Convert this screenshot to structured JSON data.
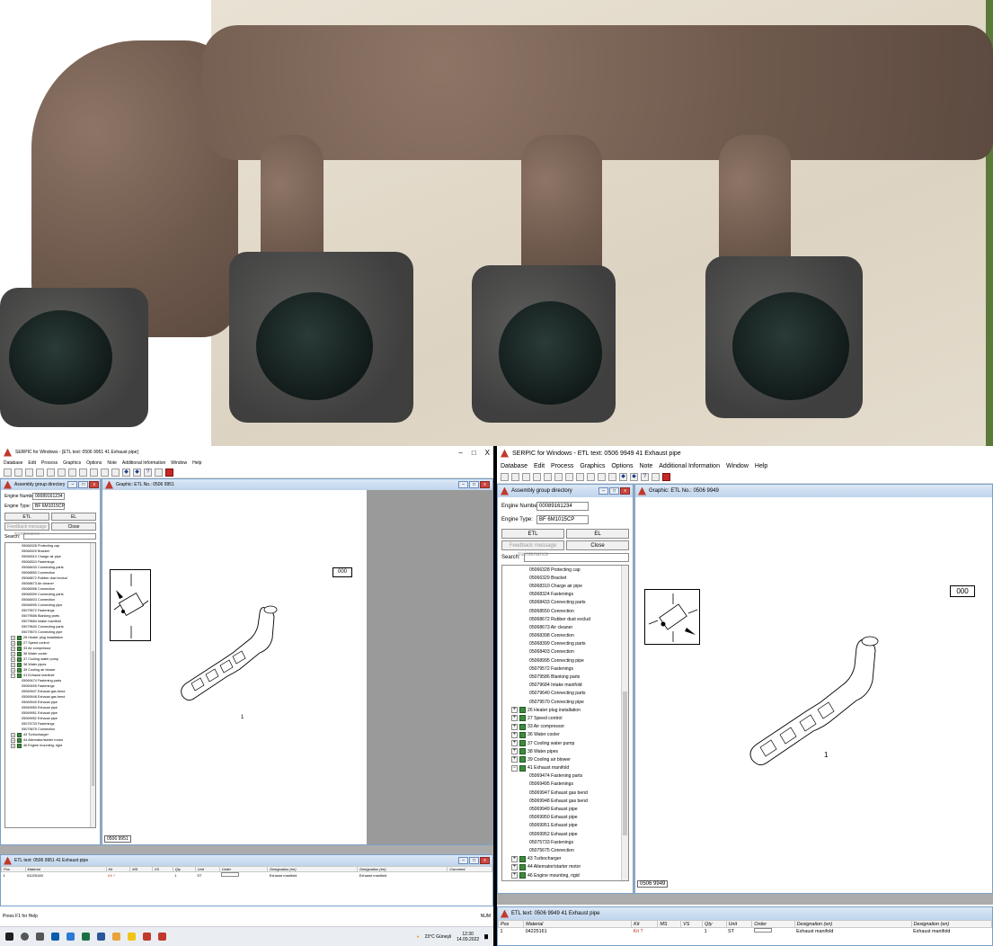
{
  "left_window": {
    "title": "SERPIC for Windows - [ETL text: 0506 9951  41  Exhaust pipe]",
    "title_buttons": [
      "–",
      "□",
      "X"
    ],
    "menu": [
      "Database",
      "Edit",
      "Process",
      "Graphics",
      "Options",
      "Note",
      "Additional Information",
      "Window",
      "Help"
    ],
    "assembly": {
      "title": "Assembly group directory",
      "engine_number_label": "Engine Number:",
      "engine_number": "00089161234",
      "engine_type_label": "Engine Type:",
      "engine_type": "BF 6M1015CP",
      "etl_button": "ETL",
      "el_button": "EL",
      "feedback_button": "Feedback message maintenance",
      "close_button": "Close",
      "search_label": "Search:"
    },
    "graphic": {
      "title": "Graphic: ETL No.: 0506 9951",
      "ref_label": "000",
      "pos_label": "1",
      "image_id": "0506 9951"
    },
    "etl": {
      "title": "ETL text: 0506 9951  41  Exhaust pipe",
      "columns": [
        "Pos",
        "Material",
        "Kit",
        "MS",
        "VS",
        "Qty",
        "Unit",
        "Order",
        "Designation (en)",
        "Designation (en)",
        "Comment"
      ],
      "rows": [
        {
          "pos": "1",
          "material": "04225165",
          "kit": "Kit ?",
          "qty": "1",
          "unit": "ST",
          "des1": "Exhaust manifold",
          "des2": "Exhaust manifold"
        }
      ]
    },
    "status_left": "Press F1 for Help",
    "status_right": "NUM",
    "tray": {
      "weather": "23°C Güneşli",
      "time": "12:30",
      "date": "14.09.2022"
    }
  },
  "right_window": {
    "title": "SERPIC for Windows - ETL text: 0506 9949  41  Exhaust pipe",
    "menu": [
      "Database",
      "Edit",
      "Process",
      "Graphics",
      "Options",
      "Note",
      "Additional Information",
      "Window",
      "Help"
    ],
    "assembly": {
      "title": "Assembly group directory",
      "engine_number_label": "Engine Number:",
      "engine_number": "00089161234",
      "engine_type_label": "Engine Type:",
      "engine_type": "BF 6M1015CP",
      "etl_button": "ETL",
      "el_button": "EL",
      "feedback_button": "Feedback message maintenance",
      "close_button": "Close",
      "search_label": "Search:"
    },
    "graphic": {
      "title": "Graphic: ETL No.: 0506 9949",
      "ref_label": "000",
      "pos_label": "1",
      "image_id": "0506 9949"
    },
    "etl": {
      "title": "ETL text: 0506 9949  41  Exhaust pipe",
      "columns": [
        "Pos",
        "Material",
        "Kit",
        "MS",
        "VS",
        "Qty",
        "Unit",
        "Order",
        "Designation (en)",
        "Designation (en)"
      ],
      "rows": [
        {
          "pos": "1",
          "material": "04225161",
          "kit": "Kit ?",
          "qty": "1",
          "unit": "ST",
          "des1": "Exhaust manifold",
          "des2": "Exhaust manifold"
        }
      ]
    }
  },
  "tree_left": [
    {
      "kind": "leaf",
      "label": "05066328  Protecting cap"
    },
    {
      "kind": "leaf",
      "label": "05066329  Bracket"
    },
    {
      "kind": "leaf",
      "label": "05068310  Charge air pipe"
    },
    {
      "kind": "leaf",
      "label": "05068324  Fastenings"
    },
    {
      "kind": "leaf",
      "label": "05068433  Connecting parts"
    },
    {
      "kind": "leaf",
      "label": "05068550  Connection"
    },
    {
      "kind": "leaf",
      "label": "05068672  Rubber dust exclud"
    },
    {
      "kind": "leaf",
      "label": "05068673  Air cleaner"
    },
    {
      "kind": "leaf",
      "label": "05068398  Connection"
    },
    {
      "kind": "leaf",
      "label": "05068399  Connecting parts"
    },
    {
      "kind": "leaf",
      "label": "05068403  Connection"
    },
    {
      "kind": "leaf",
      "label": "05068995  Connecting pipe"
    },
    {
      "kind": "leaf",
      "label": "05079572  Fastenings"
    },
    {
      "kind": "leaf",
      "label": "05079586  Blanking parts"
    },
    {
      "kind": "leaf",
      "label": "05079684  Intake manifold"
    },
    {
      "kind": "leaf",
      "label": "05079640  Connecting parts"
    },
    {
      "kind": "leaf",
      "label": "05079570  Connecting pipe"
    },
    {
      "kind": "grp",
      "label": "26  Heater plug installation"
    },
    {
      "kind": "grp",
      "label": "27  Speed control"
    },
    {
      "kind": "grp",
      "label": "33  Air compressor"
    },
    {
      "kind": "grp",
      "label": "36  Water cooler"
    },
    {
      "kind": "grp",
      "label": "37  Cooling water pump"
    },
    {
      "kind": "grp",
      "label": "38  Water pipes"
    },
    {
      "kind": "grp",
      "label": "39  Cooling air blower"
    },
    {
      "kind": "grp",
      "label": "41  Exhaust manifold",
      "open": true
    },
    {
      "kind": "leaf",
      "label": "05069474  Fastening parts"
    },
    {
      "kind": "leaf",
      "label": "05069495  Fastenings"
    },
    {
      "kind": "leaf",
      "label": "05069947  Exhaust gas bend"
    },
    {
      "kind": "leaf",
      "label": "05069948  Exhaust gas bend"
    },
    {
      "kind": "leaf",
      "label": "05069949  Exhaust pipe"
    },
    {
      "kind": "leaf",
      "label": "05069950  Exhaust pipe"
    },
    {
      "kind": "leaf",
      "label": "05069951  Exhaust pipe"
    },
    {
      "kind": "leaf",
      "label": "05069952  Exhaust pipe"
    },
    {
      "kind": "leaf",
      "label": "05075733  Fastenings"
    },
    {
      "kind": "leaf",
      "label": "05075675  Connection"
    },
    {
      "kind": "grp",
      "label": "43  Turbocharger"
    },
    {
      "kind": "grp",
      "label": "44  Alternator/starter motor"
    },
    {
      "kind": "grp",
      "label": "46  Engine mounting, rigid"
    }
  ],
  "tree_right": [
    {
      "kind": "leaf",
      "label": "05066328  Protecting cap"
    },
    {
      "kind": "leaf",
      "label": "05066329  Bracket"
    },
    {
      "kind": "leaf",
      "label": "05068310  Charge air pipe"
    },
    {
      "kind": "leaf",
      "label": "05068324  Fastenings"
    },
    {
      "kind": "leaf",
      "label": "05068433  Connecting parts"
    },
    {
      "kind": "leaf",
      "label": "05068550  Connection"
    },
    {
      "kind": "leaf",
      "label": "05068672  Rubber dust exclud"
    },
    {
      "kind": "leaf",
      "label": "05068673  Air cleaner"
    },
    {
      "kind": "leaf",
      "label": "05068398  Connection"
    },
    {
      "kind": "leaf",
      "label": "05068399  Connecting parts"
    },
    {
      "kind": "leaf",
      "label": "05068403  Connection"
    },
    {
      "kind": "leaf",
      "label": "05068995  Connecting pipe"
    },
    {
      "kind": "leaf",
      "label": "05079572  Fastenings"
    },
    {
      "kind": "leaf",
      "label": "05079586  Blanking parts"
    },
    {
      "kind": "leaf",
      "label": "05079684  Intake manifold"
    },
    {
      "kind": "leaf",
      "label": "05079640  Connecting parts"
    },
    {
      "kind": "leaf",
      "label": "05079570  Connecting pipe"
    },
    {
      "kind": "grp",
      "label": "26  Heater plug installation"
    },
    {
      "kind": "grp",
      "label": "27  Speed control"
    },
    {
      "kind": "grp",
      "label": "33  Air compressor"
    },
    {
      "kind": "grp",
      "label": "36  Water cooler"
    },
    {
      "kind": "grp",
      "label": "37  Cooling water pump"
    },
    {
      "kind": "grp",
      "label": "38  Water pipes"
    },
    {
      "kind": "grp",
      "label": "39  Cooling air blower"
    },
    {
      "kind": "grp",
      "label": "41  Exhaust manifold",
      "open": true
    },
    {
      "kind": "leaf",
      "label": "05069474  Fastening parts"
    },
    {
      "kind": "leaf",
      "label": "05069495  Fastenings"
    },
    {
      "kind": "leaf",
      "label": "05069947  Exhaust gas bend"
    },
    {
      "kind": "leaf",
      "label": "05069948  Exhaust gas bend"
    },
    {
      "kind": "leaf",
      "label": "05069949  Exhaust pipe"
    },
    {
      "kind": "leaf",
      "label": "05069950  Exhaust pipe"
    },
    {
      "kind": "leaf",
      "label": "05069951  Exhaust pipe"
    },
    {
      "kind": "leaf",
      "label": "05069952  Exhaust pipe"
    },
    {
      "kind": "leaf",
      "label": "05075733  Fastenings"
    },
    {
      "kind": "leaf",
      "label": "05075675  Connection"
    },
    {
      "kind": "grp",
      "label": "43  Turbocharger"
    },
    {
      "kind": "grp",
      "label": "44  Alternator/starter motor"
    },
    {
      "kind": "grp",
      "label": "46  Engine mounting, rigid"
    }
  ],
  "colors": {
    "accent": "#c0392b",
    "child_title": "#bfd4ec",
    "mdi": "#ababab",
    "tree_icon": "#3d8b3d"
  }
}
